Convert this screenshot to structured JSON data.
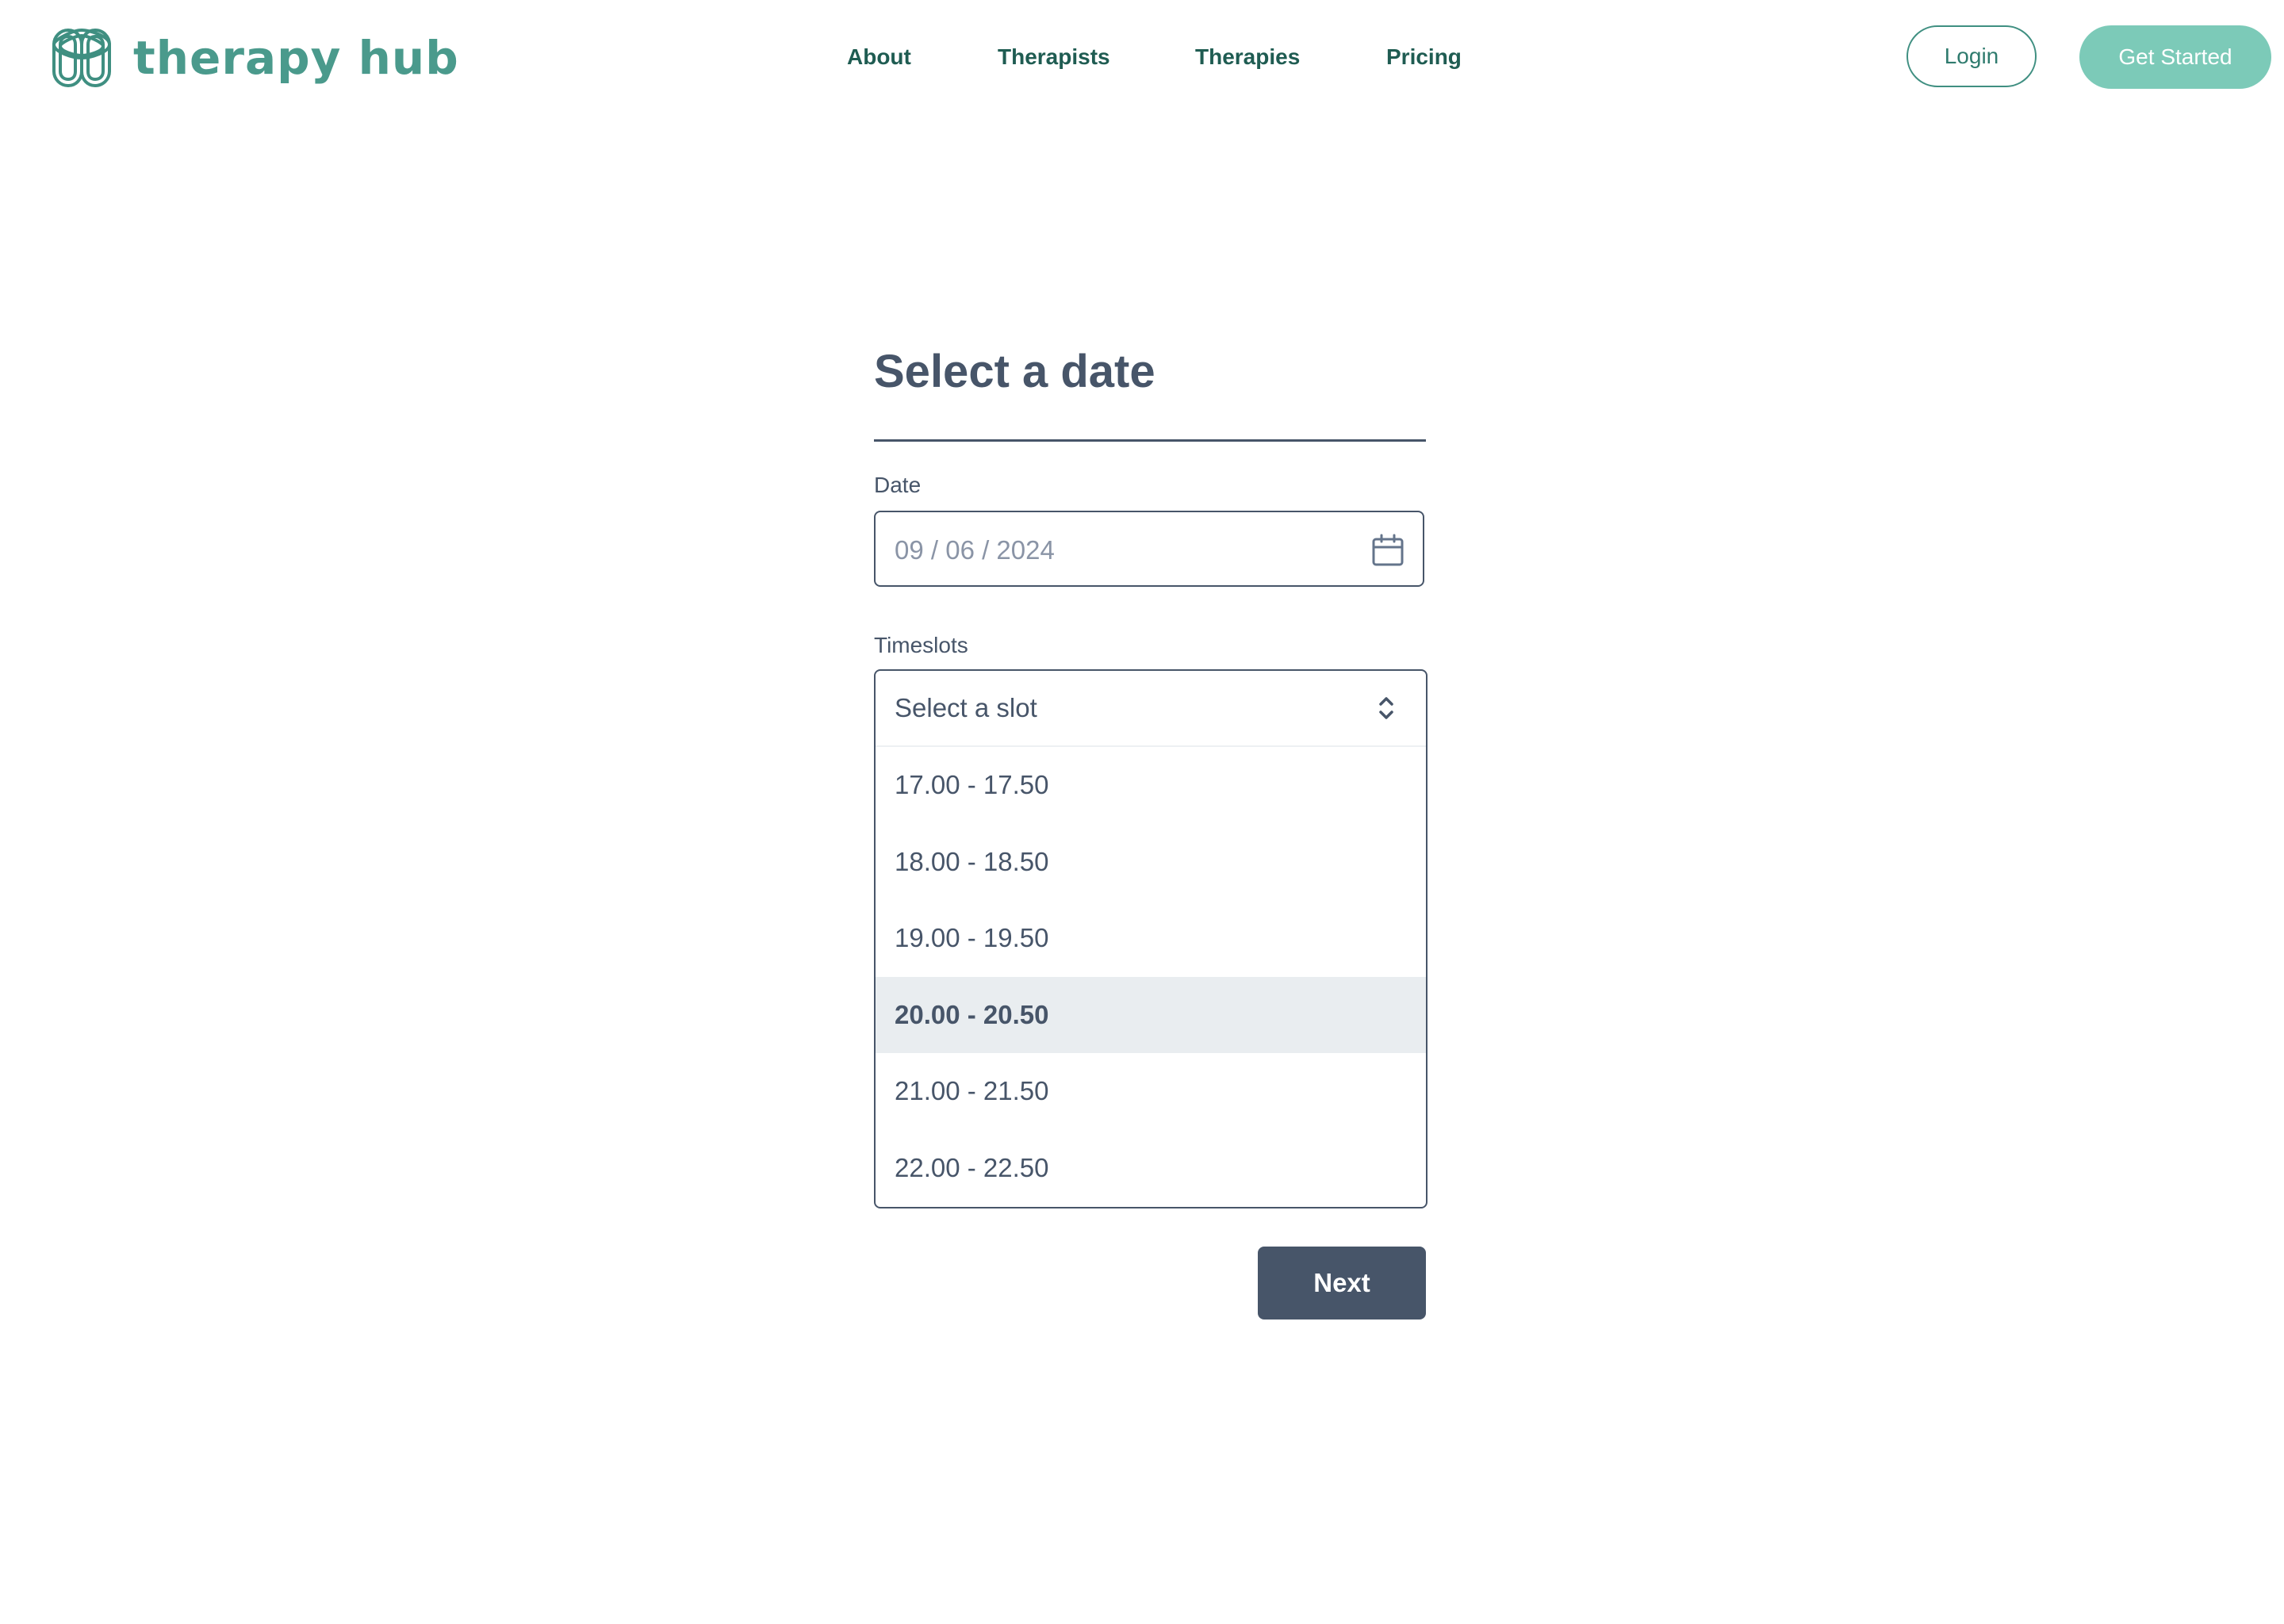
{
  "brand": {
    "name": "therapy hub",
    "color": "#4a9a8c"
  },
  "nav": {
    "items": [
      {
        "label": "About"
      },
      {
        "label": "Therapists"
      },
      {
        "label": "Therapies"
      },
      {
        "label": "Pricing"
      }
    ]
  },
  "header_actions": {
    "login_label": "Login",
    "cta_label": "Get Started",
    "cta_color": "#7ccab8"
  },
  "form": {
    "title": "Select a date",
    "date": {
      "label": "Date",
      "value": "09 / 06 / 2024",
      "icon": "calendar-icon"
    },
    "timeslots": {
      "label": "Timeslots",
      "placeholder": "Select a slot",
      "icon": "chevron-up-down-icon",
      "expanded": true,
      "highlighted_option": "20.00 - 20.50",
      "options": [
        {
          "label": "17.00 - 17.50"
        },
        {
          "label": "18.00 - 18.50"
        },
        {
          "label": "19.00 - 19.50"
        },
        {
          "label": "20.00 - 20.50"
        },
        {
          "label": "21.00 - 21.50"
        },
        {
          "label": "22.00 - 22.50"
        }
      ]
    },
    "next_label": "Next",
    "next_color": "#475569"
  }
}
